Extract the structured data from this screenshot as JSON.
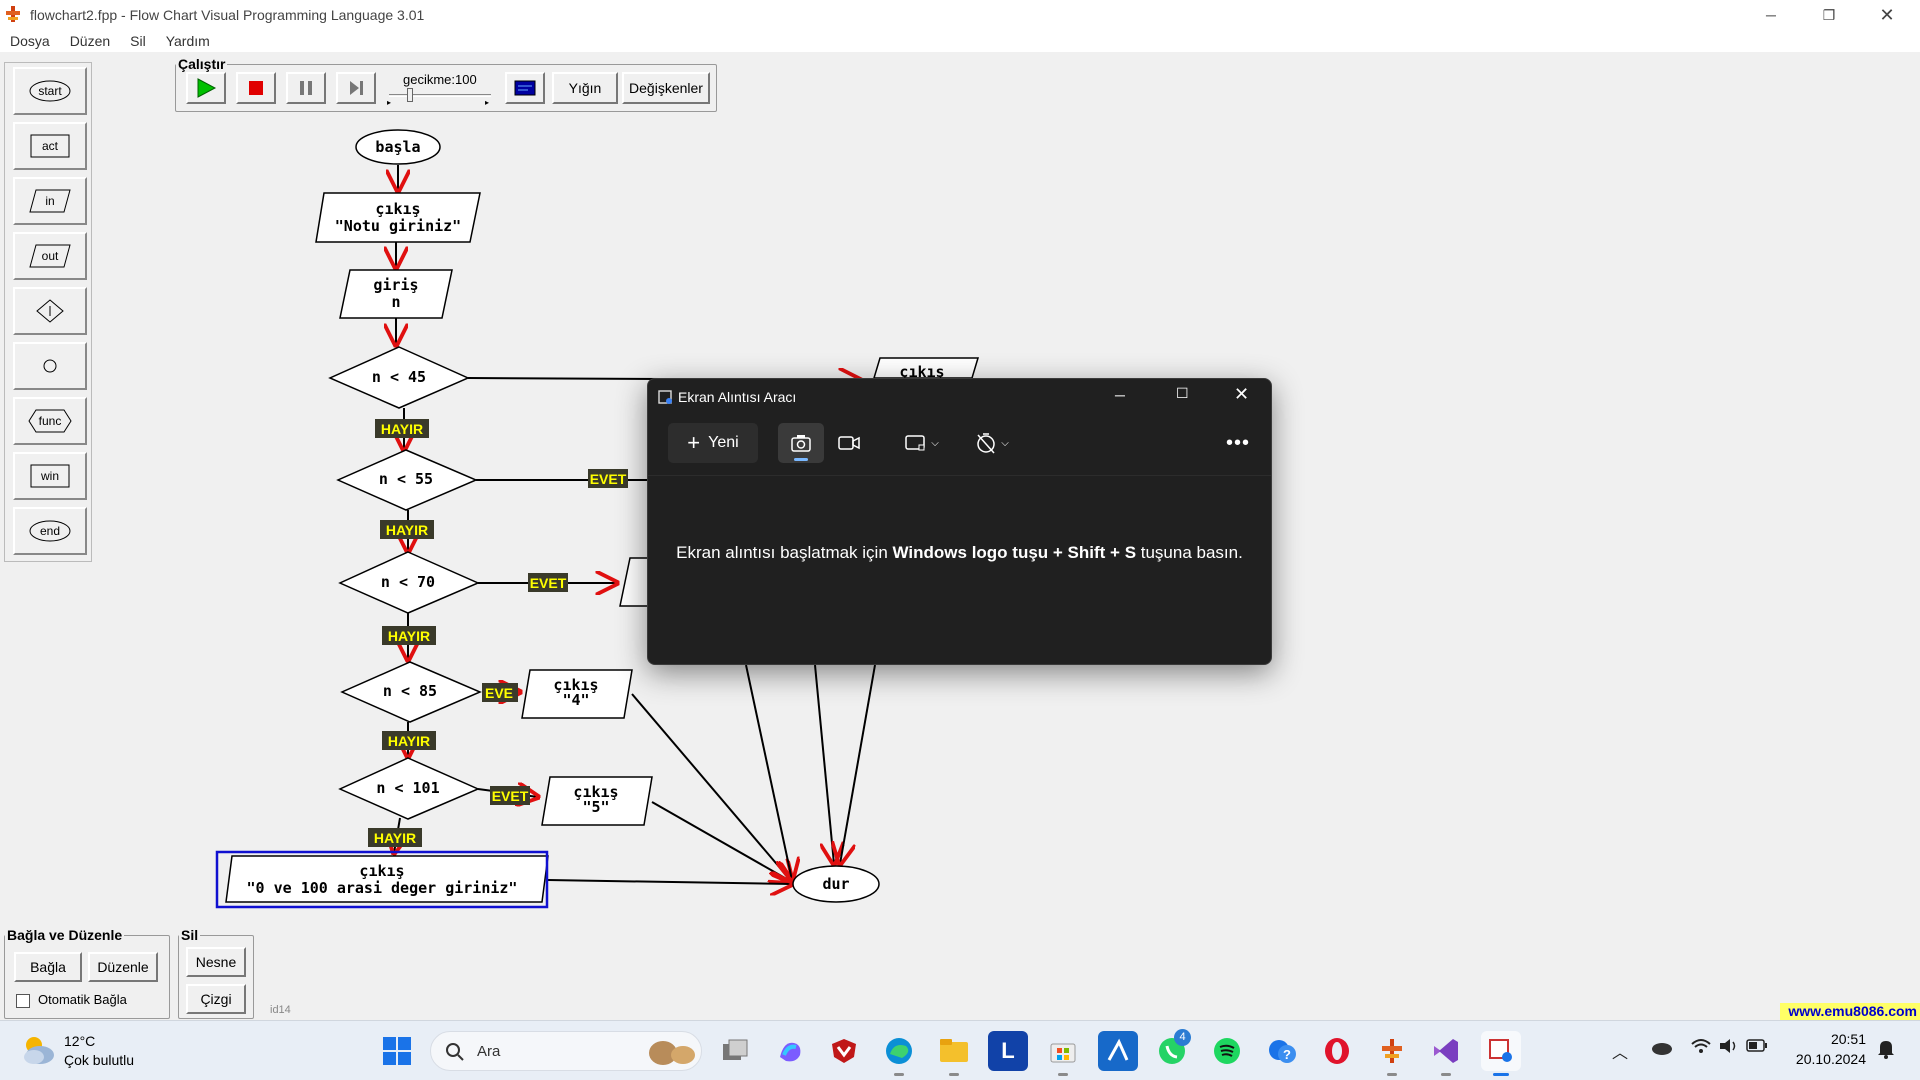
{
  "window": {
    "title": "flowchart2.fpp - Flow Chart Visual Programming Language 3.01",
    "menu": [
      "Dosya",
      "Düzen",
      "Sil",
      "Yardım"
    ]
  },
  "toolbox": {
    "items": [
      "start",
      "act",
      "in",
      "out",
      "",
      "",
      "func",
      "win",
      "end"
    ]
  },
  "run": {
    "group_label": "Çalıştır",
    "delay_label": "gecikme:100",
    "stack_label": "Yığın",
    "vars_label": "Değişkenler"
  },
  "flow": {
    "start": "başla",
    "out1_l1": "çıkış",
    "out1_l2": "\"Notu giriniz\"",
    "in1_l1": "giriş",
    "in1_l2": "n",
    "d1": "n < 45",
    "d2": "n < 55",
    "d3": "n < 70",
    "d4": "n < 85",
    "d5": "n < 101",
    "no_label": "HAYIR",
    "yes_label": "EVET",
    "yes_label_trunc": "EVE",
    "out_right_top": "çıkış",
    "out4_l1": "çıkış",
    "out4_l2": "\"4\"",
    "out5_l1": "çıkış",
    "out5_l2": "\"5\"",
    "outlast_l1": "çıkış",
    "outlast_l2": "\"0 ve 100 arasi deger giriniz\"",
    "end": "dur"
  },
  "snip": {
    "title": "Ekran Alıntısı Aracı",
    "new_label": "Yeni",
    "message_pre": "Ekran alıntısı başlatmak için ",
    "message_bold": "Windows logo tuşu + Shift + S",
    "message_post": " tuşuna basın."
  },
  "bottom": {
    "connect_group": "Bağla ve Düzenle",
    "connect_btn": "Bağla",
    "edit_btn": "Düzenle",
    "auto_connect": "Otomatik Bağla",
    "delete_group": "Sil",
    "object_btn": "Nesne",
    "line_btn": "Çizgi",
    "status_id": "id14",
    "link": "www.emu8086.com"
  },
  "taskbar": {
    "weather_temp": "12°C",
    "weather_desc": "Çok bulutlu",
    "search_placeholder": "Ara",
    "time": "20:51",
    "date": "20.10.2024",
    "whatsapp_badge": "4"
  },
  "colors": {
    "arrow": "#e01010",
    "yes_no_bg": "#3a3a2a",
    "yes_no_text": "#ffff00",
    "selection": "#0000cc",
    "snip_bg": "#202020"
  }
}
